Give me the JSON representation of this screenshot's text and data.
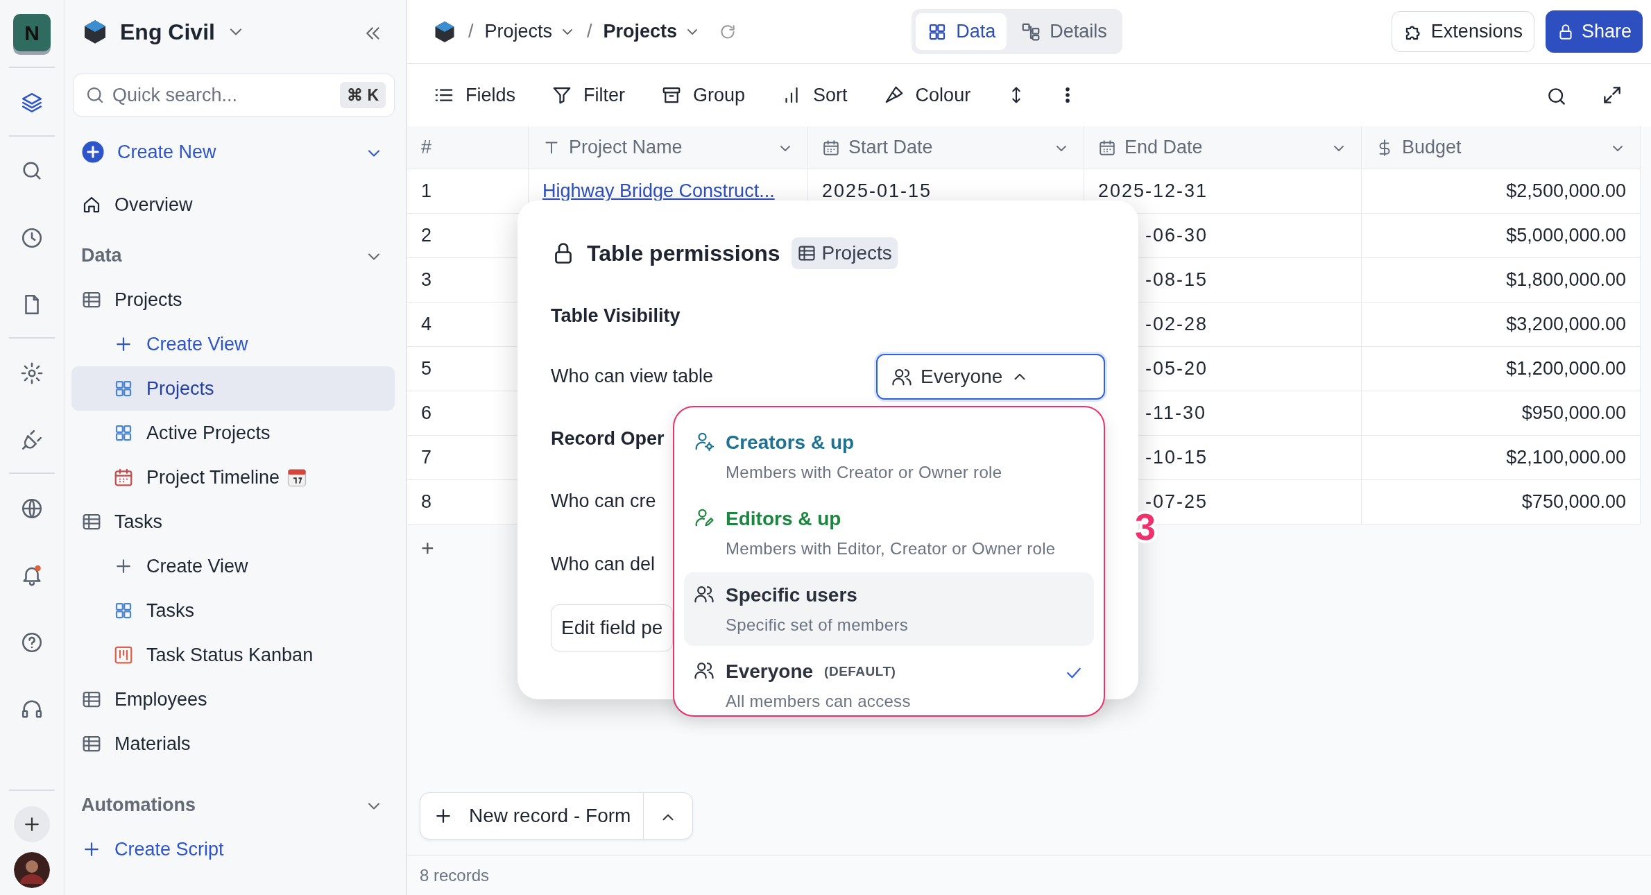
{
  "rail": {
    "workspace_initial": "N",
    "items": [
      {
        "selected": true
      },
      {
        "selected": false
      },
      {
        "selected": false
      },
      {
        "selected": false
      },
      {
        "selected": false
      },
      {
        "selected": false
      },
      {
        "selected": false
      },
      {
        "selected": false
      },
      {
        "selected": false
      },
      {
        "selected": false
      }
    ]
  },
  "sidebar": {
    "workspace": "Eng Civil",
    "search": {
      "placeholder": "Quick search...",
      "shortcut": "⌘ K"
    },
    "create_new": "Create New",
    "overview": "Overview",
    "sections": [
      {
        "title": "Data",
        "items": [
          {
            "label": "Projects",
            "kind": "table",
            "children": [
              {
                "label": "Create View",
                "kind": "create",
                "accent": true,
                "selected": false
              },
              {
                "label": "Projects",
                "kind": "grid",
                "accent": false,
                "selected": true
              },
              {
                "label": "Active Projects",
                "kind": "grid",
                "accent": false,
                "selected": false
              },
              {
                "label": "Project Timeline",
                "kind": "calendar",
                "accent": false,
                "selected": false,
                "emoji": true
              }
            ]
          },
          {
            "label": "Tasks",
            "kind": "table",
            "children": [
              {
                "label": "Create View",
                "kind": "create",
                "accent": false,
                "selected": false
              },
              {
                "label": "Tasks",
                "kind": "grid",
                "accent": false,
                "selected": false
              },
              {
                "label": "Task Status Kanban",
                "kind": "kanban",
                "accent": false,
                "selected": false
              }
            ]
          },
          {
            "label": "Employees",
            "kind": "table"
          },
          {
            "label": "Materials",
            "kind": "table"
          }
        ]
      },
      {
        "title": "Automations",
        "items": [
          {
            "label": "Create Script",
            "kind": "create",
            "accent": true
          }
        ]
      }
    ]
  },
  "header": {
    "separator": "/",
    "breadcrumb": [
      "Projects",
      "Projects"
    ],
    "tabs": [
      {
        "label": "Data",
        "kind": "data",
        "selected": true
      },
      {
        "label": "Details",
        "kind": "details",
        "selected": false
      }
    ],
    "extensions": "Extensions",
    "share": "Share"
  },
  "toolbar": [
    {
      "label": "Fields",
      "kind": "fields"
    },
    {
      "label": "Filter",
      "kind": "filter"
    },
    {
      "label": "Group",
      "kind": "group"
    },
    {
      "label": "Sort",
      "kind": "sort"
    },
    {
      "label": "Colour",
      "kind": "colour"
    }
  ],
  "table": {
    "columns": [
      {
        "label": "#",
        "kind": "index"
      },
      {
        "label": "Project Name",
        "kind": "text"
      },
      {
        "label": "Start Date",
        "kind": "date"
      },
      {
        "label": "End Date",
        "kind": "date"
      },
      {
        "label": "Budget",
        "kind": "currency"
      }
    ],
    "rows": [
      {
        "number": "1",
        "project_name": "Highway Bridge Construct...",
        "start_date": "2025-01-15",
        "end_date": "2025-12-31",
        "budget": "$2,500,000.00"
      },
      {
        "number": "2",
        "end_date": "-06-30",
        "budget": "$5,000,000.00"
      },
      {
        "number": "3",
        "end_date": "-08-15",
        "budget": "$1,800,000.00"
      },
      {
        "number": "4",
        "end_date": "-02-28",
        "budget": "$3,200,000.00"
      },
      {
        "number": "5",
        "end_date": "-05-20",
        "budget": "$1,200,000.00"
      },
      {
        "number": "6",
        "end_date": "-11-30",
        "budget": "$950,000.00"
      },
      {
        "number": "7",
        "end_date": "-10-15",
        "budget": "$2,100,000.00"
      },
      {
        "number": "8",
        "end_date": "-07-25",
        "budget": "$750,000.00"
      }
    ],
    "add_row": "+"
  },
  "new_record": "New record - Form",
  "record_count": "8 records",
  "modal": {
    "title": "Table permissions",
    "table_chip": "Projects",
    "visibility_heading": "Table Visibility",
    "view_label": "Who can view table",
    "view_value": "Everyone",
    "view_open": true,
    "record_heading": "Record Oper",
    "create_label": "Who can cre",
    "delete_label": "Who can del",
    "edit_button": "Edit field pe",
    "options": [
      {
        "kind": "creators",
        "title": "Creators & up",
        "description": "Members with Creator or Owner role",
        "color": "#1f7193",
        "highlighted": false,
        "selected": false
      },
      {
        "kind": "editors",
        "title": "Editors & up",
        "description": "Members with Editor, Creator or Owner role",
        "color": "#1e8540",
        "highlighted": false,
        "selected": false
      },
      {
        "kind": "specific",
        "title": "Specific users",
        "description": "Specific set of members",
        "color": "#2b303b",
        "highlighted": true,
        "selected": false
      },
      {
        "kind": "everyone",
        "title": "Everyone",
        "tag": "(DEFAULT)",
        "description": "All members can access",
        "color": "#2b303b",
        "highlighted": false,
        "selected": true
      }
    ],
    "annotation": "3"
  }
}
